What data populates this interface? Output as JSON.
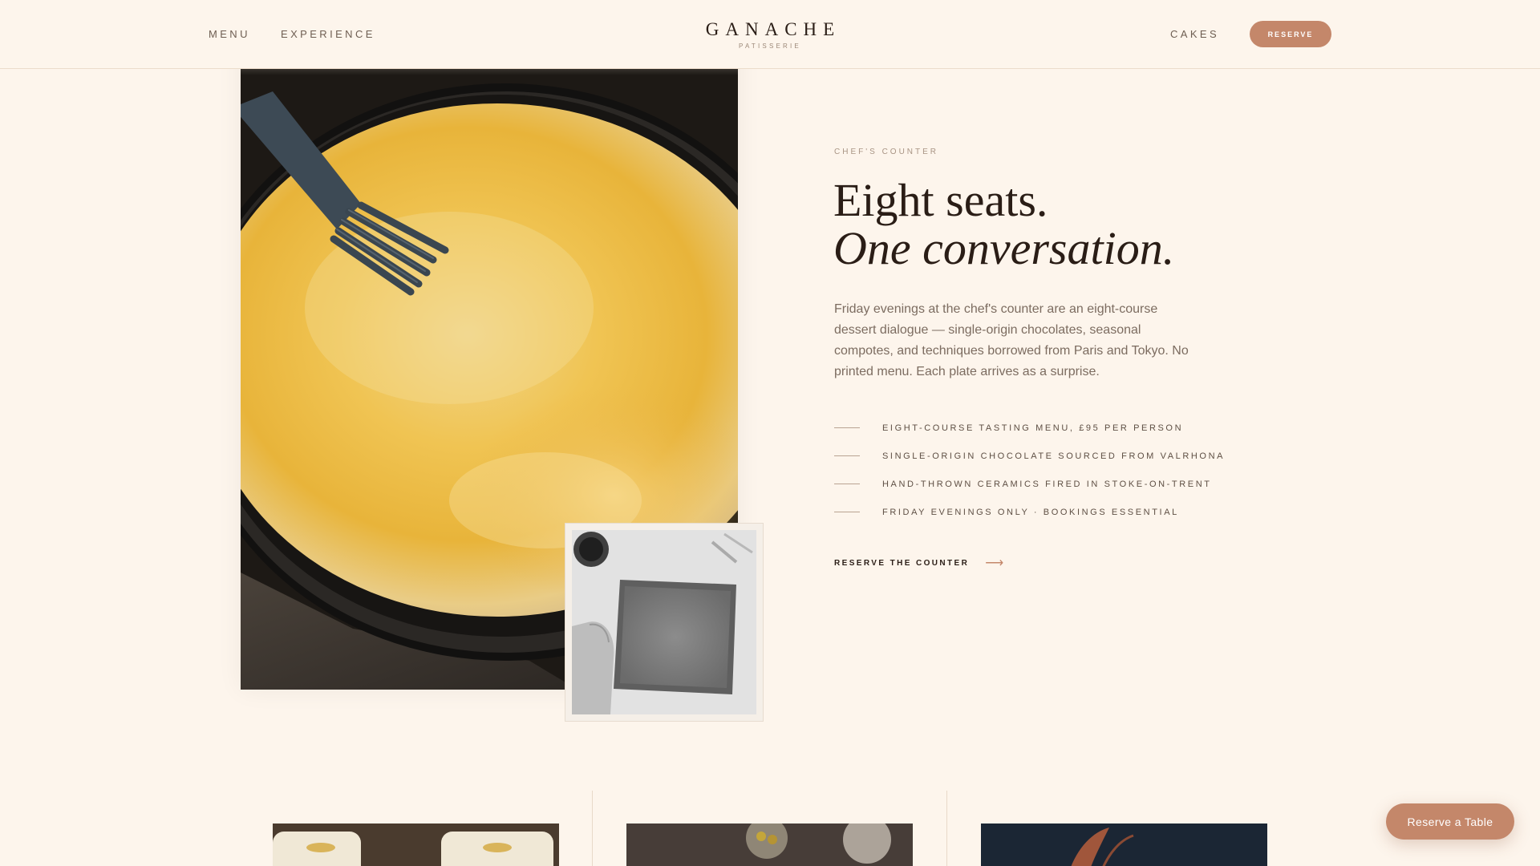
{
  "nav": {
    "menu_label": "MENU",
    "experience_label": "EXPERIENCE",
    "brand_name": "GANACHE",
    "brand_sub": "PATISSERIE",
    "cakes_label": "CAKES",
    "reserve_label": "RESERVE"
  },
  "hero": {
    "eyebrow": "CHEF'S COUNTER",
    "headline_line1": "Eight seats.",
    "headline_line2": "One conversation.",
    "lede": "Friday evenings at the chef's counter are an eight-course dessert dialogue — single-origin chocolates, seasonal compotes, and techniques borrowed from Paris and Tokyo. No printed menu. Each plate arrives as a surprise.",
    "features": [
      "EIGHT-COURSE TASTING MENU, £95 PER PERSON",
      "SINGLE-ORIGIN CHOCOLATE SOURCED FROM VALRHONA",
      "HAND-THROWN CERAMICS FIRED IN STOKE-ON-TRENT",
      "FRIDAY EVENINGS ONLY · BOOKINGS ESSENTIAL"
    ],
    "cta_label": "RESERVE THE COUNTER",
    "cta_icon": "arrow-right-icon"
  },
  "floating": {
    "reserve_table_label": "Reserve a Table"
  },
  "colors": {
    "background": "#fdf5ec",
    "accent": "#c4876a",
    "ink": "#2a1d16",
    "muted": "#7c6c60"
  }
}
